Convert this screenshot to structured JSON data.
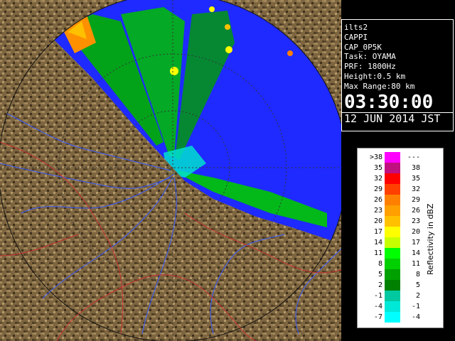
{
  "info": {
    "lines": [
      "ilts2",
      "CAPPI",
      "CAP_0P5K",
      "Task: OYAMA",
      "PRF: 1800Hz",
      "Height:0.5 km",
      "Max Range:80 km"
    ],
    "time": "03:30:00",
    "date": "12 JUN 2014 JST"
  },
  "legend": {
    "title": "Reflectivity in dBZ",
    "rows": [
      {
        "lo": ">38",
        "hi": "---",
        "color": "#ff00ff"
      },
      {
        "lo": "35",
        "hi": "38",
        "color": "#c0107f"
      },
      {
        "lo": "32",
        "hi": "35",
        "color": "#ff0000"
      },
      {
        "lo": "29",
        "hi": "32",
        "color": "#ff4000"
      },
      {
        "lo": "26",
        "hi": "29",
        "color": "#ff8000"
      },
      {
        "lo": "23",
        "hi": "26",
        "color": "#ffa000"
      },
      {
        "lo": "20",
        "hi": "23",
        "color": "#ffc000"
      },
      {
        "lo": "17",
        "hi": "20",
        "color": "#ffff00"
      },
      {
        "lo": "14",
        "hi": "17",
        "color": "#c8ff00"
      },
      {
        "lo": "11",
        "hi": "14",
        "color": "#00ff00"
      },
      {
        "lo": "8",
        "hi": "11",
        "color": "#00d000"
      },
      {
        "lo": "5",
        "hi": "8",
        "color": "#00a000"
      },
      {
        "lo": "2",
        "hi": "5",
        "color": "#008000"
      },
      {
        "lo": "-1",
        "hi": "2",
        "color": "#00c8a0"
      },
      {
        "lo": "-4",
        "hi": "-1",
        "color": "#00e8d8"
      },
      {
        "lo": "-7",
        "hi": "-4",
        "color": "#00ffff"
      }
    ]
  },
  "colors": {
    "sea": "#1e2aff",
    "land": "#8a6e44",
    "landDark": "#4a3a20",
    "rangeRing": "#202020"
  }
}
